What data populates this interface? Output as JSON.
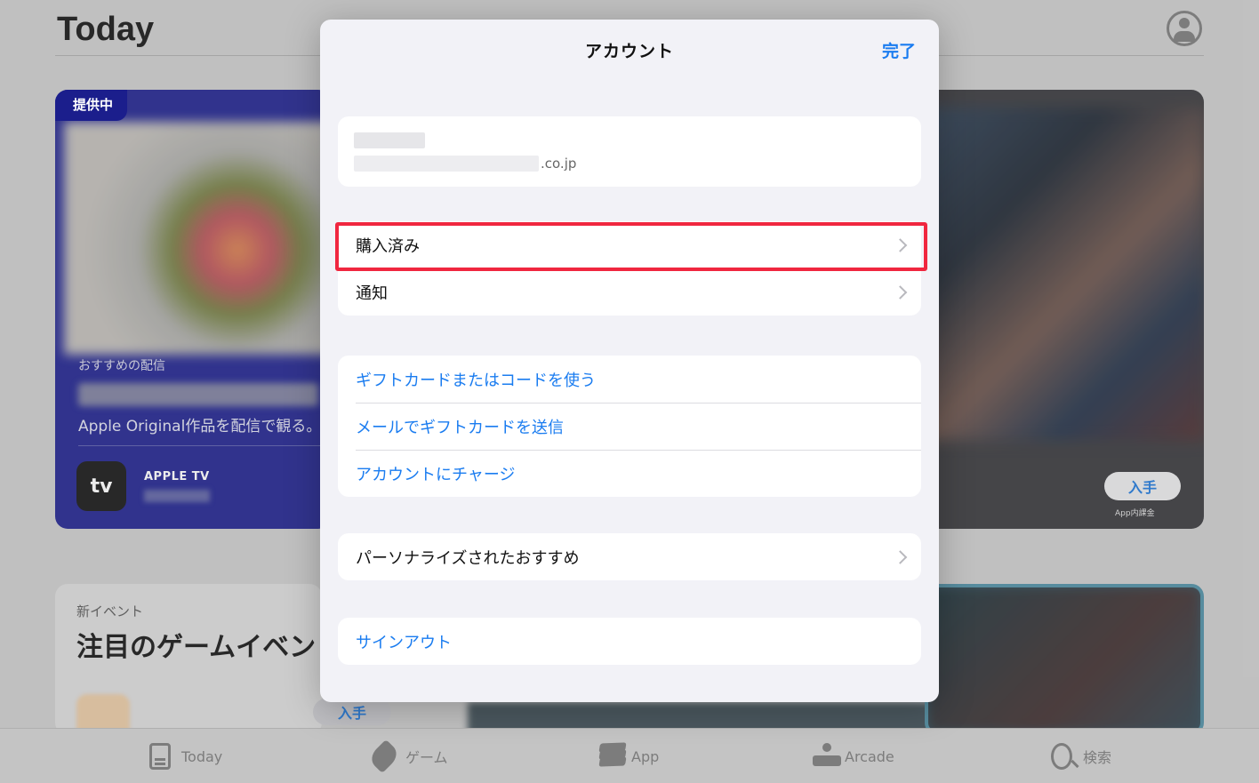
{
  "background": {
    "page_title": "Today",
    "featured_card": {
      "badge": "提供中",
      "subtitle": "おすすめの配信",
      "description": "Apple Original作品を配信で観る。",
      "app_icon_label": "tv",
      "app_name": "APPLE TV"
    },
    "right_card": {
      "get_label": "入手",
      "in_app_note": "App内課金"
    },
    "event_card": {
      "tag": "新イベント",
      "headline": "注目のゲームイベン",
      "get_label": "入手"
    },
    "tabbar": [
      {
        "label": "Today",
        "icon": "today-icon"
      },
      {
        "label": "ゲーム",
        "icon": "rocket-icon"
      },
      {
        "label": "App",
        "icon": "layers-icon"
      },
      {
        "label": "Arcade",
        "icon": "joystick-icon"
      },
      {
        "label": "検索",
        "icon": "search-icon"
      }
    ]
  },
  "sheet": {
    "title": "アカウント",
    "done_label": "完了",
    "account": {
      "email_suffix": ".co.jp"
    },
    "group_purchases": [
      {
        "label": "購入済み",
        "highlighted": true
      },
      {
        "label": "通知"
      }
    ],
    "group_gift": [
      {
        "label": "ギフトカードまたはコードを使う"
      },
      {
        "label": "メールでギフトカードを送信"
      },
      {
        "label": "アカウントにチャージ"
      }
    ],
    "group_personal": [
      {
        "label": "パーソナライズされたおすすめ"
      }
    ],
    "sign_out_label": "サインアウト"
  },
  "colors": {
    "accent": "#1a7cf0",
    "highlight_border": "#f0263f",
    "featured_card_bg": "#1b1e8c",
    "sheet_bg": "#f2f2f7"
  }
}
